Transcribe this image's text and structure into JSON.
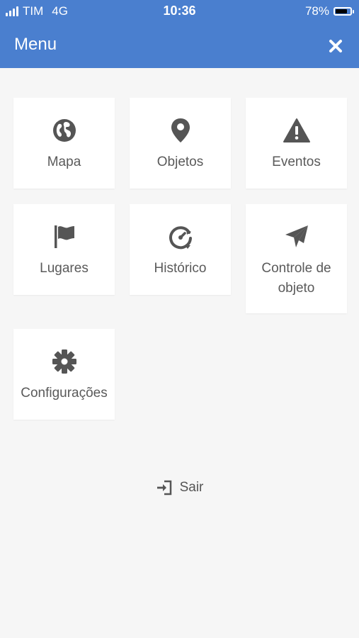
{
  "status": {
    "carrier": "TIM",
    "network": "4G",
    "time": "10:36",
    "battery_text": "78%",
    "battery_level": 0.78
  },
  "header": {
    "title": "Menu",
    "close_icon": "close-icon"
  },
  "menu": {
    "items": [
      {
        "label": "Mapa",
        "icon": "globe-icon"
      },
      {
        "label": "Objetos",
        "icon": "map-pin-icon"
      },
      {
        "label": "Eventos",
        "icon": "warning-icon"
      },
      {
        "label": "Lugares",
        "icon": "flag-icon"
      },
      {
        "label": "Histórico",
        "icon": "history-icon"
      },
      {
        "label": "Controle de objeto",
        "icon": "paper-plane-icon"
      },
      {
        "label": "Configurações",
        "icon": "gear-icon"
      }
    ]
  },
  "logout": {
    "label": "Sair",
    "icon": "sign-in-icon"
  },
  "colors": {
    "header_bg": "#4a7fcf",
    "page_bg": "#f6f6f6",
    "icon": "#555555"
  }
}
